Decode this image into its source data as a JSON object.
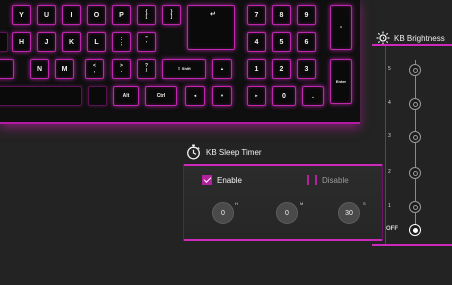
{
  "keyboard": {
    "keys": [
      {
        "name": "key-y",
        "label": "Y"
      },
      {
        "name": "key-u",
        "label": "U"
      },
      {
        "name": "key-i",
        "label": "I"
      },
      {
        "name": "key-o",
        "label": "O"
      },
      {
        "name": "key-p",
        "label": "P"
      },
      {
        "name": "key-open-bracket",
        "label": "{\n["
      },
      {
        "name": "key-close-bracket",
        "label": "}\n]"
      },
      {
        "name": "key-enter",
        "label": "↵"
      },
      {
        "name": "key-numpad-7",
        "label": "7"
      },
      {
        "name": "key-numpad-8",
        "label": "8"
      },
      {
        "name": "key-numpad-9",
        "label": "9"
      },
      {
        "name": "key-numpad-minus",
        "label": "-"
      },
      {
        "name": "key-h",
        "label": "H"
      },
      {
        "name": "key-j",
        "label": "J"
      },
      {
        "name": "key-k",
        "label": "K"
      },
      {
        "name": "key-l",
        "label": "L"
      },
      {
        "name": "key-semicolon",
        "label": ":\n;"
      },
      {
        "name": "key-quote",
        "label": "\"\n'"
      },
      {
        "name": "key-numpad-4",
        "label": "4"
      },
      {
        "name": "key-numpad-5",
        "label": "5"
      },
      {
        "name": "key-numpad-6",
        "label": "6"
      },
      {
        "name": "key-n",
        "label": "N"
      },
      {
        "name": "key-m",
        "label": "M"
      },
      {
        "name": "key-comma",
        "label": "<\n,"
      },
      {
        "name": "key-period",
        "label": ">\n."
      },
      {
        "name": "key-slash",
        "label": "?\n/"
      },
      {
        "name": "key-right-shift",
        "label": "⇧ Shift"
      },
      {
        "name": "key-arrow-up",
        "label": "▲"
      },
      {
        "name": "key-numpad-1",
        "label": "1"
      },
      {
        "name": "key-numpad-2",
        "label": "2"
      },
      {
        "name": "key-numpad-3",
        "label": "3"
      },
      {
        "name": "key-numpad-enter",
        "label": "Enter"
      },
      {
        "name": "key-alt",
        "label": "Alt"
      },
      {
        "name": "key-ctrl",
        "label": "Ctrl"
      },
      {
        "name": "key-arrow-left",
        "label": "◄"
      },
      {
        "name": "key-arrow-down",
        "label": "▼"
      },
      {
        "name": "key-arrow-right",
        "label": "►"
      },
      {
        "name": "key-numpad-0",
        "label": "0"
      },
      {
        "name": "key-numpad-dot",
        "label": "."
      }
    ],
    "accent_color": "#c424b0"
  },
  "brightness": {
    "title": "KB Brightness",
    "icon": "sun-icon",
    "levels": [
      "5",
      "4",
      "3",
      "2",
      "1",
      "OFF"
    ],
    "selected": "OFF"
  },
  "sleep_timer": {
    "title": "KB Sleep Timer",
    "icon": "stopwatch-icon",
    "enable_label": "Enable",
    "disable_label": "Disable",
    "enabled": true,
    "hours": "0",
    "minutes": "0",
    "seconds": "30",
    "hours_unit": "H",
    "minutes_unit": "M",
    "seconds_unit": "S"
  }
}
